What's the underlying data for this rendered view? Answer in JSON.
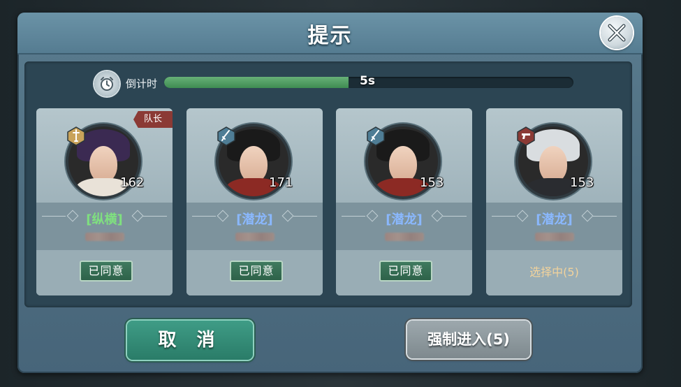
{
  "dialog": {
    "title": "提示",
    "timer": {
      "label": "倒计时",
      "value_text": "5s",
      "progress": 0.45
    },
    "cards": [
      {
        "level": "162",
        "title_tag": "[纵横]",
        "title_color": "#7fe07f",
        "status": "已同意",
        "status_type": "agreed",
        "captain_tag": "队长",
        "role_icon": "sword-badge-icon",
        "badge_color": "#c9a35a",
        "hair_color": "#3b2a52",
        "body_color": "#e9e2d8"
      },
      {
        "level": "171",
        "title_tag": "[潜龙]",
        "title_color": "#8ab8ff",
        "status": "已同意",
        "status_type": "agreed",
        "role_icon": "blade-badge-icon",
        "badge_color": "#4f7d95",
        "hair_color": "#1a1a1a",
        "body_color": "#8c2a24"
      },
      {
        "level": "153",
        "title_tag": "[潜龙]",
        "title_color": "#8ab8ff",
        "status": "已同意",
        "status_type": "agreed",
        "role_icon": "blade-badge-icon",
        "badge_color": "#4f7d95",
        "hair_color": "#1a1a1a",
        "body_color": "#8c2a24"
      },
      {
        "level": "153",
        "title_tag": "[潜龙]",
        "title_color": "#8ab8ff",
        "status": "选择中(5)",
        "status_type": "choosing",
        "role_icon": "gun-badge-icon",
        "badge_color": "#8b3a35",
        "hair_color": "#d9dde0",
        "body_color": "#2a2c30"
      }
    ]
  },
  "buttons": {
    "cancel": "取 消",
    "force_enter": "强制进入(5)"
  }
}
